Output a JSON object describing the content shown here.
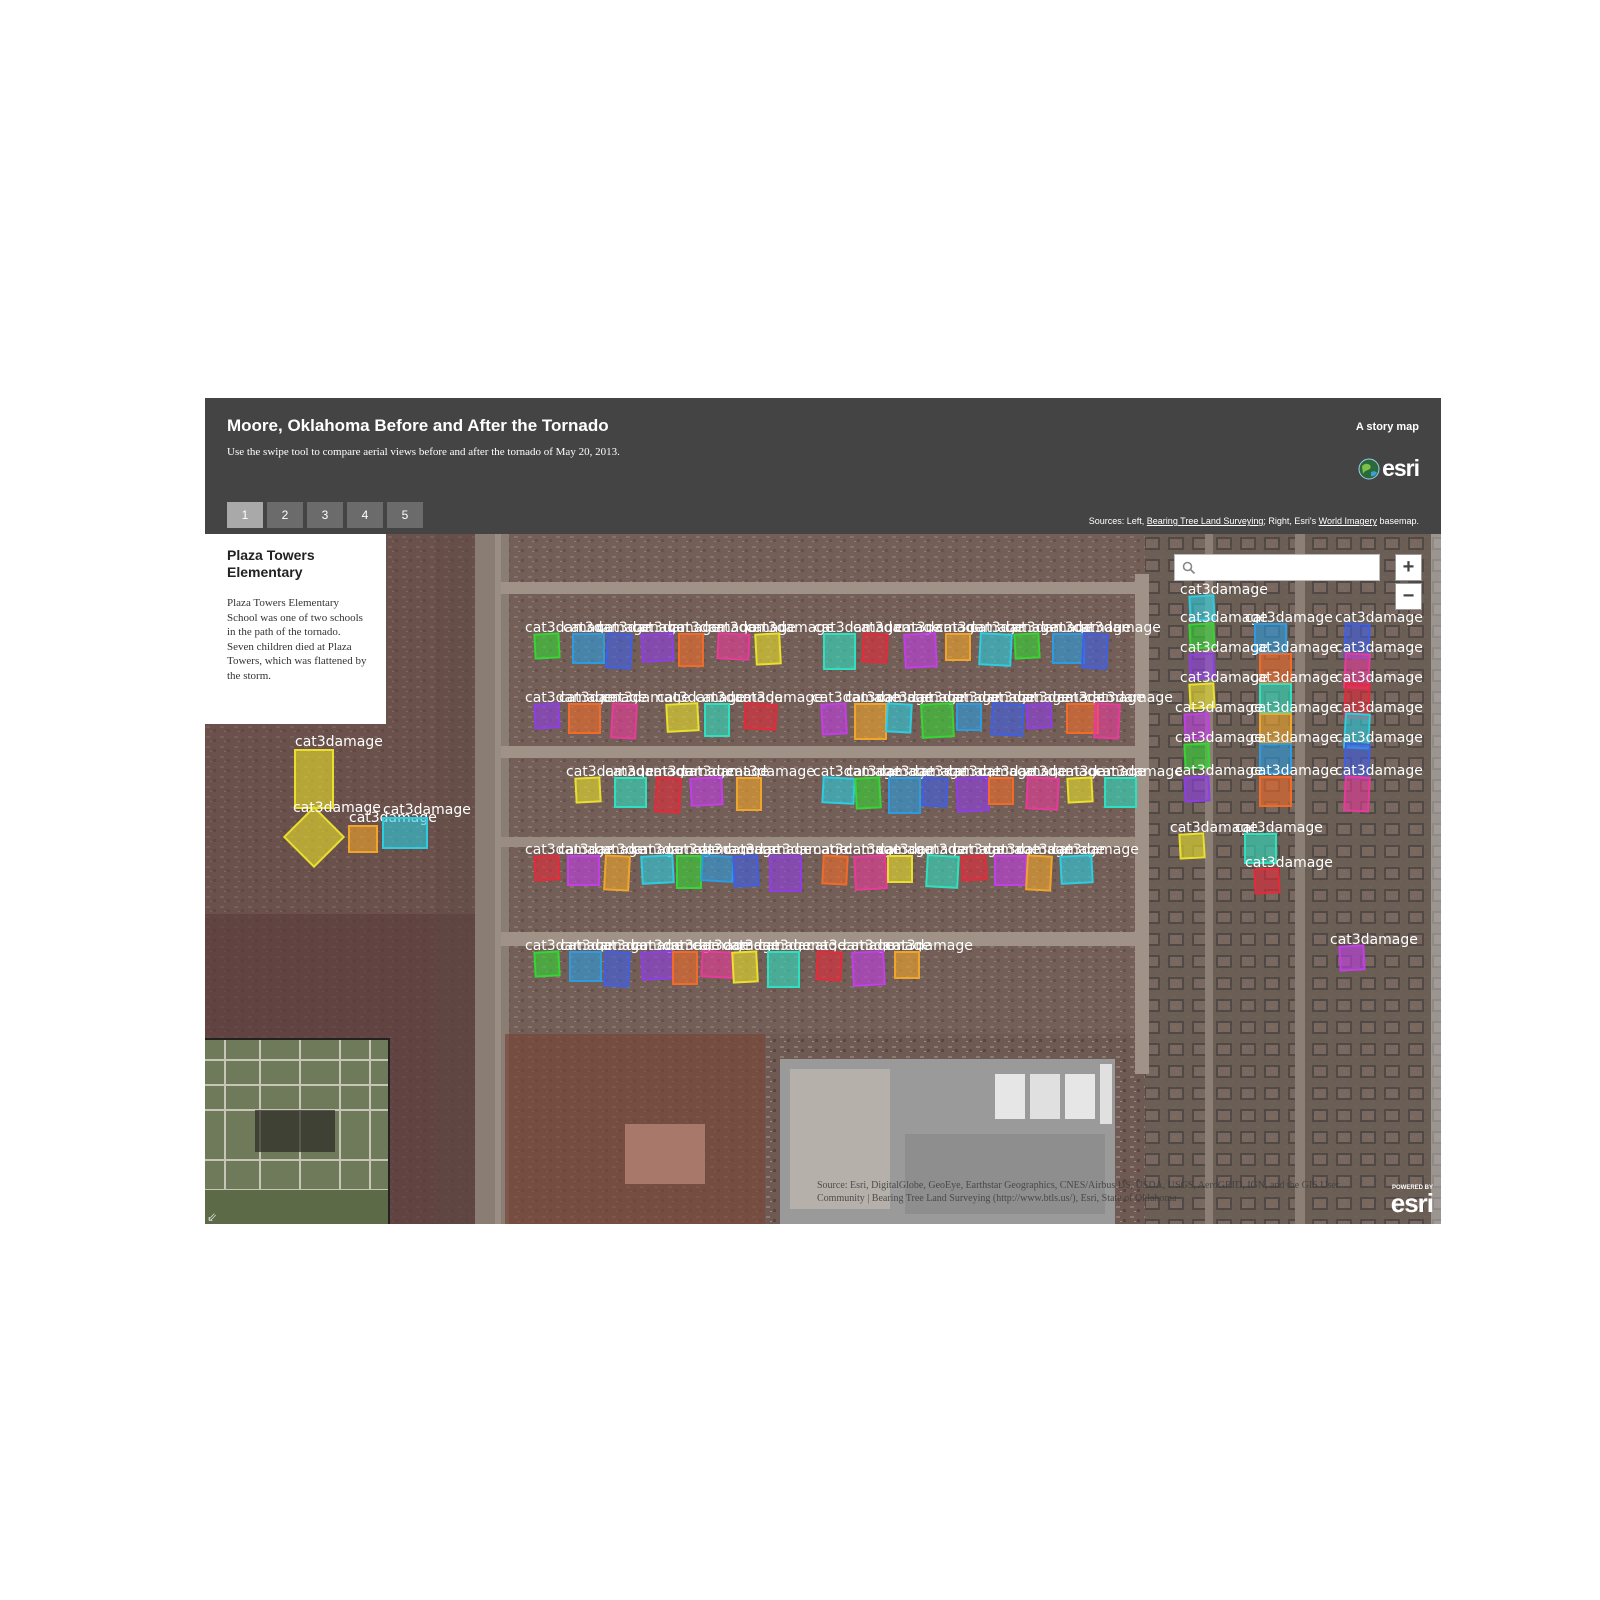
{
  "app": {
    "title": "Moore, Oklahoma Before and After the Tornado",
    "subtitle": "Use the swipe tool to compare aerial views before and after the tornado of May 20, 2013.",
    "story_map_label": "A story map",
    "logo_text": "esri"
  },
  "tabs": [
    {
      "label": "1",
      "active": true
    },
    {
      "label": "2",
      "active": false
    },
    {
      "label": "3",
      "active": false
    },
    {
      "label": "4",
      "active": false
    },
    {
      "label": "5",
      "active": false
    }
  ],
  "sources": {
    "prefix": "Sources: Left, ",
    "left_link": "Bearing Tree Land Surveying",
    "middle": "; Right, Esri's ",
    "right_link": "World Imagery",
    "suffix": " basemap."
  },
  "info_panel": {
    "title": "Plaza Towers Elementary",
    "body": "Plaza Towers Elementary School was one of two schools in the path of the tornado. Seven children died at Plaza Towers, which was flattened by the storm."
  },
  "search": {
    "placeholder": "",
    "value": ""
  },
  "zoom": {
    "in_label": "+",
    "out_label": "−"
  },
  "attribution": "Source: Esri, DigitalGlobe, GeoEye, Earthstar Geographics, CNES/Airbus DS, USDA, USGS, AeroGRID, IGN, and the GIS User Community | Bearing Tree Land Surveying (http://www.btls.us/), Esri, State of Oklahoma",
  "powered_by": {
    "small": "POWERED BY",
    "big": "esri"
  },
  "overview_toggle_icon": "arrow-icon",
  "damage_annotation_label": "cat3damage",
  "damage_marker_colors": [
    "#34d534",
    "#2c9be0",
    "#3f5fe6",
    "#8f3ee6",
    "#f06a2a",
    "#e83a9a",
    "#e8e02c",
    "#2fe0c0",
    "#e52a3a",
    "#c23ee6",
    "#f0a52a",
    "#2ccde0"
  ]
}
